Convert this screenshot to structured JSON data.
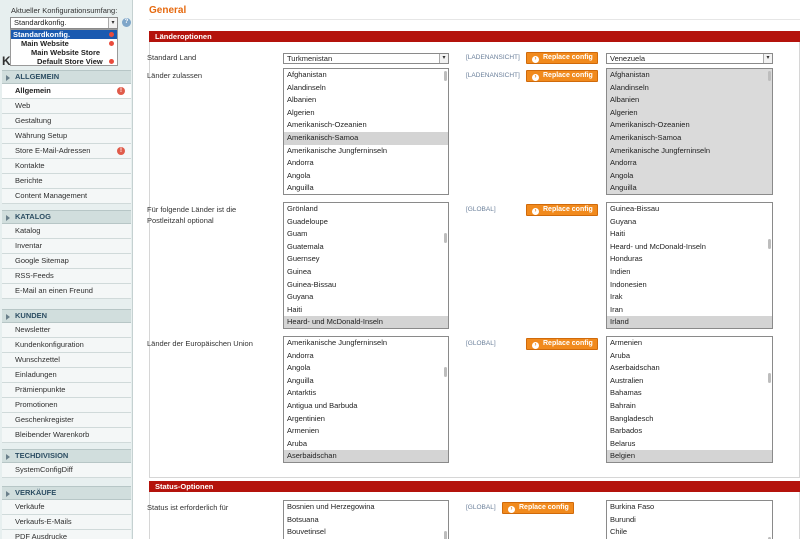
{
  "scope": {
    "label": "Aktueller Konfigurationsumfang:",
    "selected": "Standardkonfig.",
    "dropdown": [
      "Standardkonfig.",
      "Main Website",
      "Main Website Store",
      "Default Store View"
    ]
  },
  "sidebar": {
    "header_letter": "K",
    "sections": [
      {
        "title": "ALLGEMEIN",
        "items": [
          {
            "label": "Allgemein",
            "active": true,
            "warn": true
          },
          {
            "label": "Web"
          },
          {
            "label": "Gestaltung"
          },
          {
            "label": "Währung Setup"
          },
          {
            "label": "Store E-Mail-Adressen",
            "warn": true
          },
          {
            "label": "Kontakte"
          },
          {
            "label": "Berichte"
          },
          {
            "label": "Content Management"
          }
        ]
      },
      {
        "title": "KATALOG",
        "items": [
          {
            "label": "Katalog"
          },
          {
            "label": "Inventar"
          },
          {
            "label": "Google Sitemap"
          },
          {
            "label": "RSS-Feeds"
          },
          {
            "label": "E-Mail an einen Freund"
          }
        ]
      },
      {
        "title": "KUNDEN",
        "items": [
          {
            "label": "Newsletter"
          },
          {
            "label": "Kundenkonfiguration"
          },
          {
            "label": "Wunschzettel"
          },
          {
            "label": "Einladungen"
          },
          {
            "label": "Prämienpunkte"
          },
          {
            "label": "Promotionen"
          },
          {
            "label": "Geschenkregister"
          },
          {
            "label": "Bleibender Warenkorb"
          }
        ]
      },
      {
        "title": "TECHDIVISION",
        "items": [
          {
            "label": "SystemConfigDiff"
          }
        ]
      },
      {
        "title": "VERKÄUFE",
        "items": [
          {
            "label": "Verkäufe"
          },
          {
            "label": "Verkaufs-E-Mails"
          },
          {
            "label": "PDF Ausdrucke"
          }
        ]
      }
    ]
  },
  "main": {
    "title": "General",
    "replace_label": "Replace config",
    "fieldsets": [
      {
        "title": "Länderoptionen",
        "fields": [
          {
            "label": "Standard Land",
            "type": "select",
            "value": "Turkmenistan",
            "scope": "[LADENANSICHT]",
            "other_value": "Venezuela"
          },
          {
            "label": "Länder zulassen",
            "type": "multi",
            "scope": "[LADENANSICHT]",
            "options": [
              "Afghanistan",
              "Alandinseln",
              "Albanien",
              "Algerien",
              "Amerikanisch-Ozeanien",
              "Amerikanisch-Samoa",
              "Amerikanische Jungferninseln",
              "Andorra",
              "Angola",
              "Anguilla"
            ],
            "selected": [
              "Amerikanisch-Samoa"
            ],
            "other_options": [
              "Afghanistan",
              "Alandinseln",
              "Albanien",
              "Algerien",
              "Amerikanisch-Ozeanien",
              "Amerikanisch-Samoa",
              "Amerikanische Jungferninseln",
              "Andorra",
              "Angola",
              "Anguilla"
            ]
          },
          {
            "label": "Für folgende Länder ist die Postleitzahl optional",
            "type": "multi",
            "scope": "[GLOBAL]",
            "options": [
              "Grönland",
              "Guadeloupe",
              "Guam",
              "Guatemala",
              "Guernsey",
              "Guinea",
              "Guinea-Bissau",
              "Guyana",
              "Haiti",
              "Heard- und McDonald-Inseln"
            ],
            "selected": [
              "Heard- und McDonald-Inseln"
            ],
            "other_options": [
              "Guinea-Bissau",
              "Guyana",
              "Haiti",
              "Heard- und McDonald-Inseln",
              "Honduras",
              "Indien",
              "Indonesien",
              "Irak",
              "Iran",
              "Irland"
            ],
            "other_selected": [
              "Irland"
            ]
          },
          {
            "label": "Länder der Europäischen Union",
            "type": "multi",
            "scope": "[GLOBAL]",
            "options": [
              "Amerikanische Jungferninseln",
              "Andorra",
              "Angola",
              "Anguilla",
              "Antarktis",
              "Antigua und Barbuda",
              "Argentinien",
              "Armenien",
              "Aruba",
              "Aserbaidschan"
            ],
            "selected": [
              "Aserbaidschan"
            ],
            "other_options": [
              "Armenien",
              "Aruba",
              "Aserbaidschan",
              "Australien",
              "Bahamas",
              "Bahrain",
              "Bangladesch",
              "Barbados",
              "Belarus",
              "Belgien"
            ],
            "other_selected": [
              "Belgien"
            ]
          }
        ]
      },
      {
        "title": "Status-Optionen",
        "fields": [
          {
            "label": "Status ist erforderlich für",
            "type": "multi",
            "scope": "[GLOBAL]",
            "options": [
              "Bosnien und Herzegowina",
              "Botsuana",
              "Bouvetinsel"
            ],
            "other_options": [
              "Burkina Faso",
              "Burundi",
              "Chile"
            ]
          }
        ]
      }
    ]
  }
}
